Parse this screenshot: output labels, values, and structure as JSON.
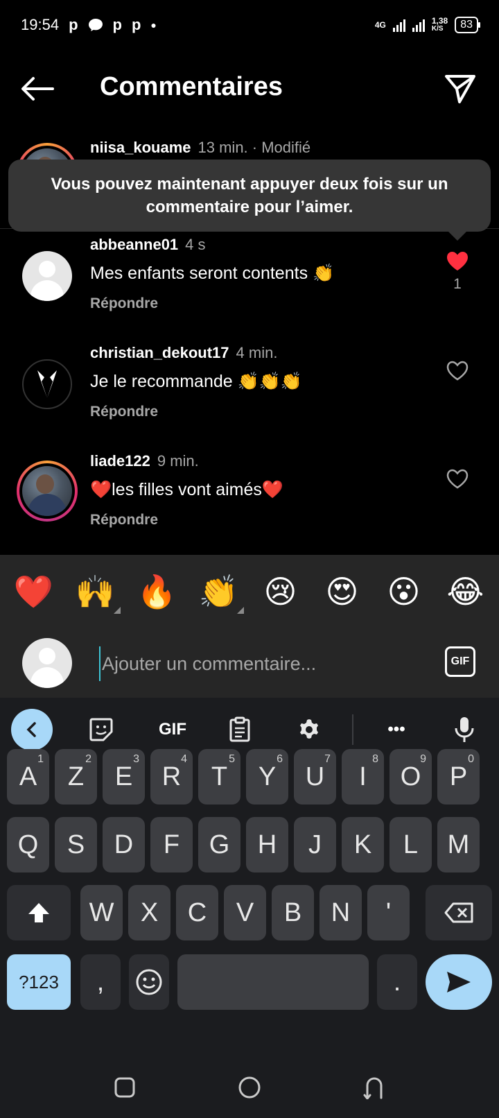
{
  "status_bar": {
    "time": "19:54",
    "left_icons": [
      "p",
      "chat",
      "p",
      "p"
    ],
    "network": "4G",
    "speed_value": "1,38",
    "speed_unit": "K/S",
    "battery": "83"
  },
  "header": {
    "title": "Commentaires"
  },
  "top_comment": {
    "username": "niisa_kouame",
    "meta": "13 min. · Modifié"
  },
  "tooltip": {
    "text": "Vous pouvez maintenant appuyer deux fois sur un commentaire pour l’aimer."
  },
  "comments": [
    {
      "username": "abbeanne01",
      "time": "4 s",
      "text": "Mes enfants seront contents 👏",
      "reply": "Répondre",
      "liked": true,
      "like_count": "1",
      "avatar": "default-avatar"
    },
    {
      "username": "christian_dekout17",
      "time": "4 min.",
      "text": "Je le recommande 👏👏👏",
      "reply": "Répondre",
      "liked": false,
      "like_count": "",
      "avatar": "suit-logo-avatar"
    },
    {
      "username": "liade122",
      "time": "9 min.",
      "text": "❤️les filles vont aimés❤️",
      "reply": "Répondre",
      "liked": false,
      "like_count": "",
      "avatar": "photo-avatar-with-story-ring"
    }
  ],
  "emoji_bar": [
    "❤️",
    "🙌",
    "🔥",
    "👏",
    "😢",
    "😍",
    "😮",
    "😂"
  ],
  "comment_input": {
    "placeholder": "Ajouter un commentaire...",
    "gif_label": "GIF"
  },
  "keyboard": {
    "toolbar": {
      "gif_label": "GIF",
      "more_label": "•••"
    },
    "row1": [
      {
        "key": "A",
        "hint": "1"
      },
      {
        "key": "Z",
        "hint": "2"
      },
      {
        "key": "E",
        "hint": "3"
      },
      {
        "key": "R",
        "hint": "4"
      },
      {
        "key": "T",
        "hint": "5"
      },
      {
        "key": "Y",
        "hint": "6"
      },
      {
        "key": "U",
        "hint": "7"
      },
      {
        "key": "I",
        "hint": "8"
      },
      {
        "key": "O",
        "hint": "9"
      },
      {
        "key": "P",
        "hint": "0"
      }
    ],
    "row2": [
      "Q",
      "S",
      "D",
      "F",
      "G",
      "H",
      "J",
      "K",
      "L",
      "M"
    ],
    "row3": [
      "W",
      "X",
      "C",
      "V",
      "B",
      "N",
      "'"
    ],
    "row4": {
      "symbols": "?123",
      "comma": ",",
      "period": "."
    }
  },
  "colors": {
    "background": "#000000",
    "tooltip": "#363636",
    "like_red": "#ff3040",
    "secondary_text": "#a8a8a8",
    "keyboard_bg": "#1b1c1f",
    "key_bg": "#3d3e42",
    "accent_blue": "#a8d8f8"
  }
}
